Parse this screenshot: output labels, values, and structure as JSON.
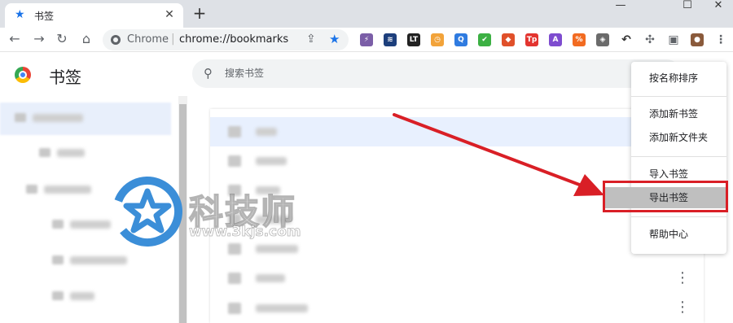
{
  "tab": {
    "title": "书签",
    "close_glyph": "✕"
  },
  "new_tab_glyph": "+",
  "window_controls": {
    "minimize": "—",
    "maximize": "☐",
    "close": "✕"
  },
  "toolbar": {
    "back": "←",
    "forward": "→",
    "reload": "↻",
    "home": "⌂",
    "omnibox_scheme": "Chrome",
    "omnibox_url": "chrome://bookmarks",
    "extensions": [
      {
        "icon": "purple-bolt-icon",
        "label": "⚡",
        "color": "#7b5ea7"
      },
      {
        "icon": "blue-wave-icon",
        "label": "≋",
        "color": "#1d3f7c"
      },
      {
        "icon": "lt-icon",
        "label": "LT",
        "color": "#222222"
      },
      {
        "icon": "orange-clock-icon",
        "label": "◷",
        "color": "#f2a33a"
      },
      {
        "icon": "blue-q-icon",
        "label": "Q",
        "color": "#2f7be0"
      },
      {
        "icon": "green-check-icon",
        "label": "✔",
        "color": "#3cb043"
      },
      {
        "icon": "brave-lion-icon",
        "label": "◆",
        "color": "#e0502a"
      },
      {
        "icon": "tp-icon",
        "label": "Tp",
        "color": "#e3342f"
      },
      {
        "icon": "purple-a-icon",
        "label": "A",
        "color": "#7e4ccf"
      },
      {
        "icon": "orange-percent-icon",
        "label": "%",
        "color": "#f26b21"
      },
      {
        "icon": "ublock-shield-icon",
        "label": "◈",
        "color": "#6b6b6b"
      },
      {
        "icon": "curl-arrow-icon",
        "label": "↶",
        "color": "#333333"
      },
      {
        "icon": "puzzle-icon",
        "label": "✣",
        "color": "#5f6368"
      },
      {
        "icon": "side-panel-icon",
        "label": "▣",
        "color": "#5f6368"
      },
      {
        "icon": "profile-avatar-icon",
        "label": "●",
        "color": "#8a5a3b"
      },
      {
        "icon": "menu-kebab-icon",
        "label": "⋮",
        "color": "#5f6368"
      }
    ]
  },
  "page": {
    "title": "书签",
    "search_placeholder": "搜索书签",
    "search_glyph": "⚲"
  },
  "rows": [
    {
      "more": ""
    },
    {
      "more": ""
    },
    {
      "more": ""
    },
    {
      "more": ""
    },
    {
      "more": ""
    },
    {
      "more": ""
    },
    {
      "more": "⋮"
    },
    {
      "more": "⋮"
    }
  ],
  "menu": {
    "sort_by_name": "按名称排序",
    "add_bookmark": "添加新书签",
    "add_folder": "添加新文件夹",
    "import_bookmarks": "导入书签",
    "export_bookmarks": "导出书签",
    "help_center": "帮助中心"
  },
  "watermark": {
    "title": "科技师",
    "url": "www.3kjs.com"
  },
  "colors": {
    "accent": "#1a73e8",
    "annotation_red": "#d91f26",
    "highlight": "#bfbfbf"
  }
}
